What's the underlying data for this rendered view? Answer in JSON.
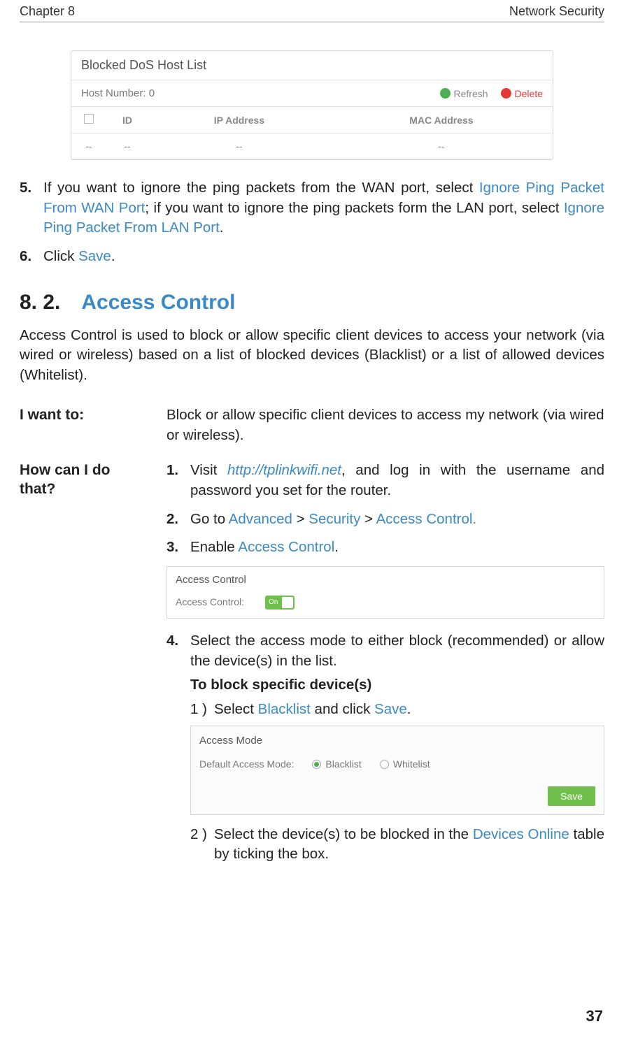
{
  "header": {
    "left": "Chapter 8",
    "right": "Network Security"
  },
  "fig1": {
    "title": "Blocked DoS Host List",
    "host_label": "Host Number: 0",
    "refresh": "Refresh",
    "delete": "Delete",
    "cols": {
      "id": "ID",
      "ip": "IP Address",
      "mac": "MAC Address"
    },
    "row": {
      "c1": "--",
      "c2": "--",
      "c3": "--",
      "c4": "--"
    }
  },
  "steps_top": {
    "n5": "5.",
    "t5a": "If you want to ignore the ping packets from the WAN port, select ",
    "t5link1": "Ignore Ping Packet From WAN Port",
    "t5b": "; if you want to ignore the ping packets form the LAN port, select ",
    "t5link2": "Ignore Ping Packet From LAN Port",
    "t5c": ".",
    "n6": "6.",
    "t6a": "Click ",
    "t6link": "Save",
    "t6b": "."
  },
  "section": {
    "num": "8. 2.",
    "title": "Access Control"
  },
  "intro": "Access Control is used to block or allow specific client devices to access your network (via wired or wireless) based on a list of blocked devices (Blacklist) or a list of allowed devices (Whitelist).",
  "iwant": {
    "label": "I want to:",
    "body": "Block or allow specific client devices to access my network (via wired or wireless)."
  },
  "howcan": {
    "label": "How can I do that?",
    "s1n": "1.",
    "s1a": "Visit ",
    "s1link": "http://tplinkwifi.net",
    "s1b": ", and log in with the username and password you set for the router.",
    "s2n": "2.",
    "s2a": "Go to ",
    "s2l1": "Advanced",
    "s2s1": " > ",
    "s2l2": "Security",
    "s2s2": " > ",
    "s2l3": "Access Control.",
    "s3n": "3.",
    "s3a": "Enable ",
    "s3link": "Access Control",
    "s3b": "."
  },
  "fig2": {
    "title": "Access Control",
    "row_label": "Access Control:",
    "toggle": "On"
  },
  "step4": {
    "n": "4.",
    "text": "Select the access mode to either block (recommended) or allow the device(s) in the list.",
    "sub_title": "To block specific device(s)",
    "s1n": "1 )",
    "s1a": "Select ",
    "s1l1": "Blacklist",
    "s1b": " and click ",
    "s1l2": "Save",
    "s1c": ".",
    "s2n": "2 )",
    "s2a": "Select the device(s) to be blocked in the ",
    "s2l": "Devices Online",
    "s2b": " table by ticking the box."
  },
  "fig3": {
    "title": "Access Mode",
    "row_label": "Default Access Mode:",
    "opt1": "Blacklist",
    "opt2": "Whitelist",
    "save": "Save"
  },
  "pagenum": "37"
}
